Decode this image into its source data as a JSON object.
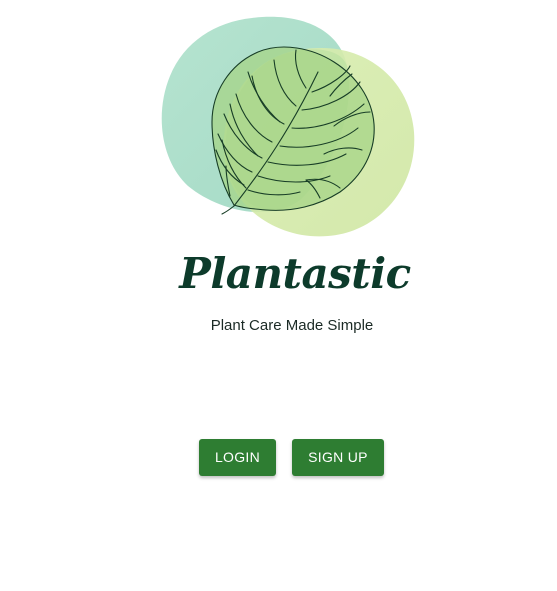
{
  "app": {
    "title": "Plantastic",
    "tagline": "Plant Care Made Simple"
  },
  "logo": {
    "icon": "monstera-leaf-icon",
    "colors": {
      "teal_blob": "#a3dcc3",
      "lime_blob": "#d2e8a7",
      "overlap": "#b5dea0",
      "leaf_fill": "#a5d487",
      "leaf_stroke": "#173d26"
    }
  },
  "actions": {
    "login_label": "LOGIN",
    "signup_label": "SIGN UP"
  },
  "theme": {
    "primary": "#2e7d32",
    "title_color": "#0d3b2b",
    "text_color": "#1b2a25",
    "background": "#ffffff"
  }
}
